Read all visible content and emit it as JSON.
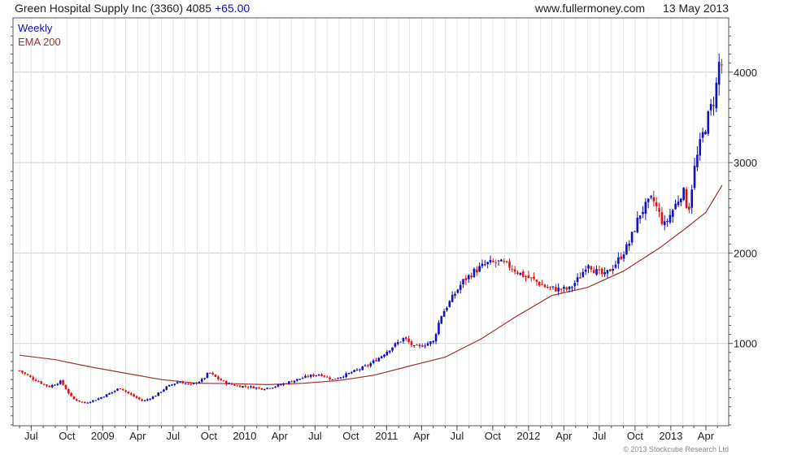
{
  "header": {
    "name": "Green Hospital Supply Inc (3360)",
    "price": "4085",
    "change": "+65.00",
    "source": "www.fullermoney.com",
    "date": "13 May 2013"
  },
  "legend": {
    "period": "Weekly",
    "ema": "EMA 200"
  },
  "colors": {
    "up": "#1010c8",
    "down": "#e01414",
    "ema": "#a03030",
    "grid": "#d0d0d0",
    "axis": "#555555"
  },
  "footer": {
    "copyright": "© 2013 Stockcube Research Ltd"
  },
  "chart_data": {
    "type": "candlestick",
    "scale": "linear",
    "grid": true,
    "legend_position": "top-left",
    "x_range": [
      "2008-06-01",
      "2013-05-13"
    ],
    "y_range": [
      90,
      4600
    ],
    "y_ticks": [
      1000,
      2000,
      3000,
      4000
    ],
    "x_ticks": [
      {
        "label": "Jul",
        "date": "2008-07-01"
      },
      {
        "label": "Oct",
        "date": "2008-10-01"
      },
      {
        "label": "2009",
        "date": "2009-01-01"
      },
      {
        "label": "Apr",
        "date": "2009-04-01"
      },
      {
        "label": "Jul",
        "date": "2009-07-01"
      },
      {
        "label": "Oct",
        "date": "2009-10-01"
      },
      {
        "label": "2010",
        "date": "2010-01-01"
      },
      {
        "label": "Apr",
        "date": "2010-04-01"
      },
      {
        "label": "Jul",
        "date": "2010-07-01"
      },
      {
        "label": "Oct",
        "date": "2010-10-01"
      },
      {
        "label": "2011",
        "date": "2011-01-01"
      },
      {
        "label": "Apr",
        "date": "2011-04-01"
      },
      {
        "label": "Jul",
        "date": "2011-07-01"
      },
      {
        "label": "Oct",
        "date": "2011-10-01"
      },
      {
        "label": "2012",
        "date": "2012-01-01"
      },
      {
        "label": "Apr",
        "date": "2012-04-01"
      },
      {
        "label": "Jul",
        "date": "2012-07-01"
      },
      {
        "label": "Oct",
        "date": "2012-10-01"
      },
      {
        "label": "2013",
        "date": "2013-01-01"
      },
      {
        "label": "Apr",
        "date": "2013-04-01"
      }
    ],
    "price_path": [
      [
        "2008-06-01",
        700
      ],
      [
        "2008-07-01",
        620
      ],
      [
        "2008-08-15",
        520
      ],
      [
        "2008-09-15",
        580
      ],
      [
        "2008-10-15",
        390
      ],
      [
        "2008-11-15",
        340
      ],
      [
        "2008-12-15",
        380
      ],
      [
        "2009-01-15",
        440
      ],
      [
        "2009-02-15",
        510
      ],
      [
        "2009-03-15",
        430
      ],
      [
        "2009-04-15",
        360
      ],
      [
        "2009-05-15",
        420
      ],
      [
        "2009-06-15",
        520
      ],
      [
        "2009-07-15",
        580
      ],
      [
        "2009-08-15",
        540
      ],
      [
        "2009-09-15",
        600
      ],
      [
        "2009-10-01",
        680
      ],
      [
        "2009-10-20",
        620
      ],
      [
        "2009-11-15",
        560
      ],
      [
        "2009-12-15",
        530
      ],
      [
        "2010-01-15",
        520
      ],
      [
        "2010-02-15",
        500
      ],
      [
        "2010-03-15",
        520
      ],
      [
        "2010-04-15",
        560
      ],
      [
        "2010-05-15",
        600
      ],
      [
        "2010-06-15",
        640
      ],
      [
        "2010-07-15",
        660
      ],
      [
        "2010-08-15",
        600
      ],
      [
        "2010-09-15",
        650
      ],
      [
        "2010-10-15",
        700
      ],
      [
        "2010-11-15",
        760
      ],
      [
        "2010-12-15",
        850
      ],
      [
        "2011-01-15",
        960
      ],
      [
        "2011-02-15",
        1060
      ],
      [
        "2011-03-15",
        950
      ],
      [
        "2011-04-15",
        1000
      ],
      [
        "2011-05-01",
        1020
      ],
      [
        "2011-05-20",
        1300
      ],
      [
        "2011-06-15",
        1480
      ],
      [
        "2011-07-15",
        1680
      ],
      [
        "2011-08-15",
        1800
      ],
      [
        "2011-09-15",
        1880
      ],
      [
        "2011-10-15",
        1900
      ],
      [
        "2011-11-15",
        1850
      ],
      [
        "2011-12-15",
        1760
      ],
      [
        "2012-01-15",
        1700
      ],
      [
        "2012-02-15",
        1620
      ],
      [
        "2012-03-15",
        1600
      ],
      [
        "2012-04-15",
        1600
      ],
      [
        "2012-05-15",
        1750
      ],
      [
        "2012-06-01",
        1900
      ],
      [
        "2012-06-20",
        1800
      ],
      [
        "2012-07-15",
        1750
      ],
      [
        "2012-08-15",
        1900
      ],
      [
        "2012-09-15",
        2100
      ],
      [
        "2012-10-15",
        2450
      ],
      [
        "2012-11-15",
        2600
      ],
      [
        "2012-12-15",
        2300
      ],
      [
        "2013-01-15",
        2550
      ],
      [
        "2013-02-01",
        2700
      ],
      [
        "2013-02-15",
        2450
      ],
      [
        "2013-03-01",
        2900
      ],
      [
        "2013-03-20",
        3250
      ],
      [
        "2013-04-10",
        3550
      ],
      [
        "2013-04-25",
        3750
      ],
      [
        "2013-05-05",
        4100
      ],
      [
        "2013-05-13",
        4085
      ]
    ],
    "ema_200": [
      [
        "2008-06-01",
        870
      ],
      [
        "2008-09-01",
        820
      ],
      [
        "2008-12-01",
        740
      ],
      [
        "2009-03-01",
        670
      ],
      [
        "2009-06-01",
        600
      ],
      [
        "2009-09-01",
        560
      ],
      [
        "2009-12-01",
        555
      ],
      [
        "2010-03-01",
        545
      ],
      [
        "2010-06-01",
        560
      ],
      [
        "2010-09-01",
        590
      ],
      [
        "2010-12-01",
        650
      ],
      [
        "2011-03-01",
        750
      ],
      [
        "2011-06-01",
        850
      ],
      [
        "2011-09-01",
        1050
      ],
      [
        "2011-12-01",
        1300
      ],
      [
        "2012-03-01",
        1530
      ],
      [
        "2012-06-01",
        1620
      ],
      [
        "2012-09-01",
        1800
      ],
      [
        "2012-12-01",
        2050
      ],
      [
        "2013-02-01",
        2250
      ],
      [
        "2013-04-01",
        2450
      ],
      [
        "2013-05-13",
        2750
      ]
    ]
  }
}
